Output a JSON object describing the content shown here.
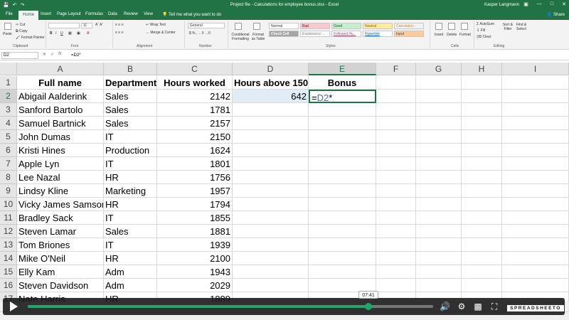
{
  "app": {
    "window_title": "Project file - Calculations for employee bonus.xlsx - Excel",
    "user": "Kasper Langmann",
    "share_label": "Share",
    "tell_me": "Tell me what you want to do"
  },
  "tabs": [
    "File",
    "Home",
    "Insert",
    "Page Layout",
    "Formulas",
    "Data",
    "Review",
    "View"
  ],
  "active_tab": "Home",
  "ribbon": {
    "clipboard": {
      "paste": "Paste",
      "cut": "Cut",
      "copy": "Copy",
      "format_painter": "Format Painter",
      "label": "Clipboard"
    },
    "font": {
      "size": "11",
      "label": "Font"
    },
    "alignment": {
      "wrap_text": "Wrap Text",
      "merge_center": "Merge & Center",
      "label": "Alignment"
    },
    "number": {
      "format": "General",
      "label": "Number"
    },
    "styles": {
      "conditional": "Conditional Formatting",
      "format_as_table": "Format as Table",
      "cells": [
        "Normal",
        "Bad",
        "Good",
        "Neutral",
        "Calculation",
        "Check Cell",
        "Explanatory ...",
        "Followed Hy...",
        "Hyperlink",
        "Input"
      ],
      "label": "Styles"
    },
    "cells": {
      "insert": "Insert",
      "delete": "Delete",
      "format": "Format",
      "label": "Cells"
    },
    "editing": {
      "autosum": "AutoSum",
      "fill": "Fill",
      "clear": "Clear",
      "sort_filter": "Sort & Filter",
      "find_select": "Find & Select",
      "label": "Editing"
    }
  },
  "formula_bar": {
    "name_box": "D2",
    "formula": "=D2*"
  },
  "columns": [
    "A",
    "B",
    "C",
    "D",
    "E",
    "F",
    "G",
    "H",
    "I"
  ],
  "headers": {
    "a": "Full name",
    "b": "Department",
    "c": "Hours worked",
    "d": "Hours above 1500",
    "e": "Bonus"
  },
  "rows": [
    {
      "n": "2",
      "name": "Abigail Aalderink",
      "dept": "Sales",
      "hours": "2142",
      "d": "642",
      "e_pre": "=",
      "e_ref": "D2",
      "e_post": "*"
    },
    {
      "n": "3",
      "name": "Sanford Bartolo",
      "dept": "Sales",
      "hours": "1781"
    },
    {
      "n": "4",
      "name": "Samuel Bartnick",
      "dept": "Sales",
      "hours": "2157"
    },
    {
      "n": "5",
      "name": "John Dumas",
      "dept": "IT",
      "hours": "2150"
    },
    {
      "n": "6",
      "name": "Kristi Hines",
      "dept": "Production",
      "hours": "1624"
    },
    {
      "n": "7",
      "name": "Apple Lyn",
      "dept": "IT",
      "hours": "1801"
    },
    {
      "n": "8",
      "name": "Lee Nazal",
      "dept": "HR",
      "hours": "1756"
    },
    {
      "n": "9",
      "name": "Lindsy Kline",
      "dept": "Marketing",
      "hours": "1957"
    },
    {
      "n": "10",
      "name": "Vicky James Samson",
      "dept": "HR",
      "hours": "1794"
    },
    {
      "n": "11",
      "name": "Bradley Sack",
      "dept": "IT",
      "hours": "1855"
    },
    {
      "n": "12",
      "name": "Steven Lamar",
      "dept": "Sales",
      "hours": "1881"
    },
    {
      "n": "13",
      "name": "Tom Briones",
      "dept": "IT",
      "hours": "1939"
    },
    {
      "n": "14",
      "name": "Mike O'Neil",
      "dept": "HR",
      "hours": "2100"
    },
    {
      "n": "15",
      "name": "Elly Kam",
      "dept": "Adm",
      "hours": "1943"
    },
    {
      "n": "16",
      "name": "Steven Davidson",
      "dept": "Adm",
      "hours": "2029"
    },
    {
      "n": "17",
      "name": "Nate Harris",
      "dept": "HR",
      "hours": "1889"
    }
  ],
  "video": {
    "time": "07:41",
    "progress": 0.84,
    "brand": "SPREADSHEETO"
  },
  "colors": {
    "excel_green": "#217346",
    "selection": "#e2ecf6",
    "progress": "#1aa86b"
  }
}
